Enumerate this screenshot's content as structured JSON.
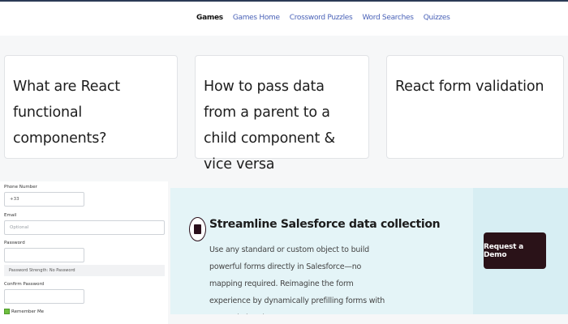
{
  "nav": {
    "items": [
      {
        "label": "Games",
        "active": true
      },
      {
        "label": "Games Home"
      },
      {
        "label": "Crossword Puzzles"
      },
      {
        "label": "Word Searches"
      },
      {
        "label": "Quizzes"
      }
    ]
  },
  "cards": [
    {
      "title": "What are React functional components?"
    },
    {
      "title": "How to pass data from a parent to a child component & vice versa"
    },
    {
      "title": "React form validation"
    }
  ],
  "form": {
    "phone_label": "Phone Number",
    "phone_value": "+33",
    "email_label": "Email",
    "email_placeholder": "Optional",
    "password_label": "Password",
    "strength_text": "Password Strength: No Password",
    "confirm_label": "Confirm Password",
    "remember_label": "Remember Me"
  },
  "promo": {
    "title": "Streamline Salesforce data collection",
    "description": "Use any standard or custom object to build powerful forms directly in Salesforce—no mapping required. Reimagine the form experience by dynamically prefilling forms with your existing data.",
    "cta_label": "Request a Demo",
    "icon": "form-document-icon"
  },
  "colors": {
    "nav_link": "#4b63b8",
    "promo_bg": "#e4f4f7",
    "cta_bg": "#2a1218"
  }
}
